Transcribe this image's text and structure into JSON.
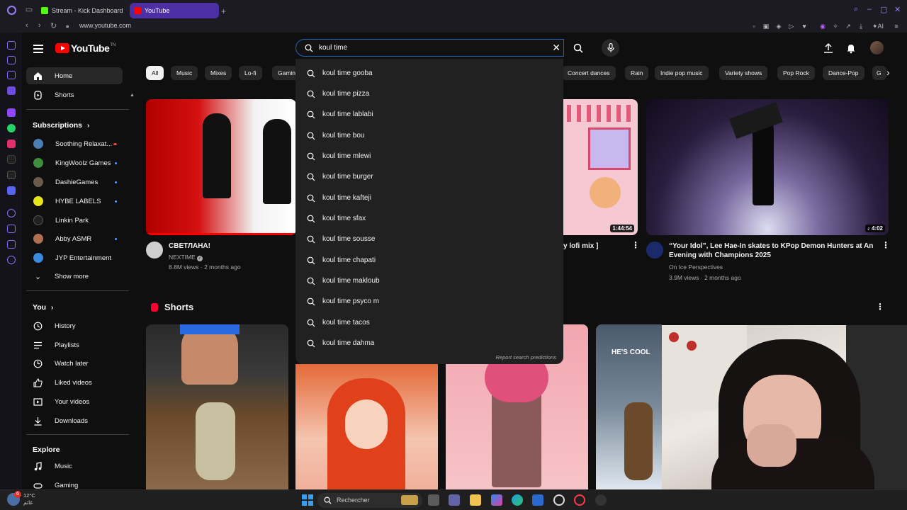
{
  "browser": {
    "tabs": [
      {
        "label": "Stream - Kick Dashboard",
        "favicon_color": "#53fc18"
      },
      {
        "label": "YouTube",
        "favicon_color": "#ff0000"
      }
    ],
    "url": "www.youtube.com",
    "accent": "#9b7cff"
  },
  "youtube": {
    "logo_text": "YouTube",
    "logo_sup": "TN",
    "search": {
      "value": "koul time",
      "suggestions": [
        "koul time gooba",
        "koul time pizza",
        "koul time lablabi",
        "koul time bou",
        "koul time mlewi",
        "koul time burger",
        "koul time kafteji",
        "koul time sfax",
        "koul time sousse",
        "koul time chapati",
        "koul time makloub",
        "koul time psyco m",
        "koul time tacos",
        "koul time dahma"
      ],
      "report": "Report search predictions"
    },
    "guide": {
      "main": [
        {
          "label": "Home",
          "icon": "home-icon"
        },
        {
          "label": "Shorts",
          "icon": "shorts-icon"
        }
      ],
      "subscriptions_title": "Subscriptions",
      "subscriptions": [
        {
          "label": "Soothing Relaxat...",
          "color": "#4b7fb0"
        },
        {
          "label": "KingWoolz Games",
          "color": "#3d8f3d"
        },
        {
          "label": "DashieGames",
          "color": "#6b5a4a"
        },
        {
          "label": "HYBE LABELS",
          "color": "#e6e61a"
        },
        {
          "label": "Linkin Park",
          "color": "#222222"
        },
        {
          "label": "Abby ASMR",
          "color": "#b07050"
        },
        {
          "label": "JYP Entertainment",
          "color": "#3a8ae0"
        }
      ],
      "show_more": "Show more",
      "you_title": "You",
      "you": [
        {
          "label": "History",
          "icon": "history-icon"
        },
        {
          "label": "Playlists",
          "icon": "playlists-icon"
        },
        {
          "label": "Watch later",
          "icon": "watch-later-icon"
        },
        {
          "label": "Liked videos",
          "icon": "like-icon"
        },
        {
          "label": "Your videos",
          "icon": "your-videos-icon"
        },
        {
          "label": "Downloads",
          "icon": "download-icon"
        }
      ],
      "explore_title": "Explore",
      "explore": [
        {
          "label": "Music",
          "icon": "music-icon"
        },
        {
          "label": "Gaming",
          "icon": "gaming-icon"
        }
      ]
    },
    "chips": [
      "All",
      "Music",
      "Mixes",
      "Lo-fi",
      "Gamin",
      "Concert dances",
      "Rain",
      "Indie pop music",
      "Variety shows",
      "Pop Rock",
      "Dance-Pop",
      "G"
    ],
    "videos": [
      {
        "title": "СВЕТЛАНА!",
        "channel": "NEXTIME",
        "meta": "8.8M views · 2 months ago"
      },
      {
        "title": "y lofi mix ]",
        "duration": "1:44:54"
      },
      {
        "title": "“Your Idol”, Lee Hae-In skates to KPop Demon Hunters at An Evening with Champions 2025",
        "channel": "On Ice Perspectives",
        "meta": "3.9M views · 2 months ago",
        "duration": "4:02"
      }
    ],
    "shorts_title": "Shorts",
    "shorts_overlay_text": "HE'S COOL"
  },
  "taskbar": {
    "temperature": "12°C",
    "weather_text": "غائم",
    "search_placeholder": "Rechercher",
    "badge": "6"
  }
}
